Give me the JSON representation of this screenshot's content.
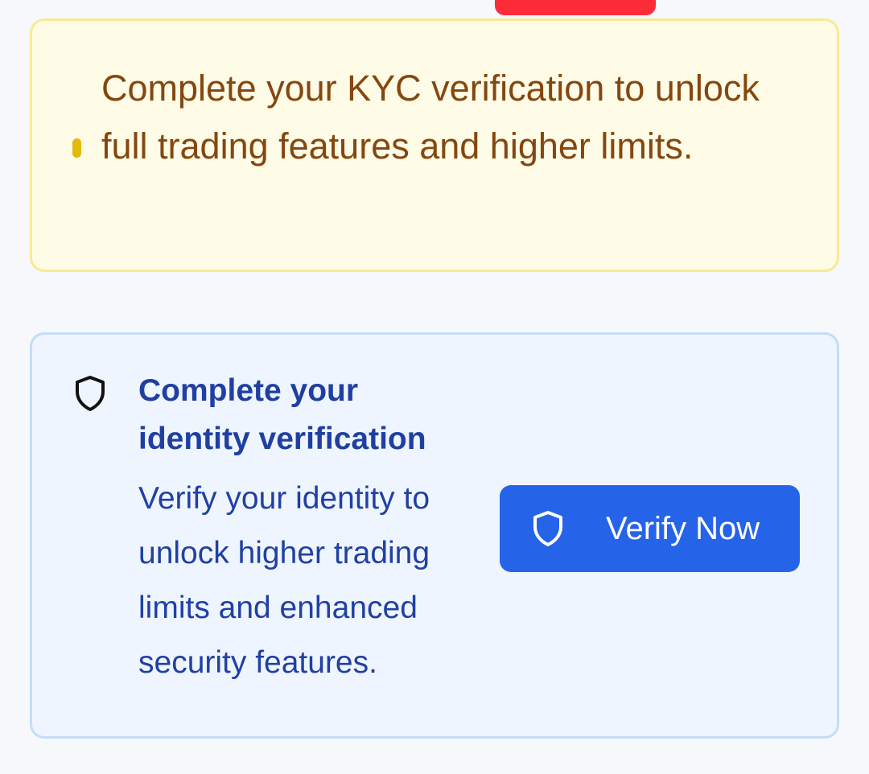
{
  "kyc_banner": {
    "message": "Complete your KYC verification to unlock full trading features and higher limits.",
    "bullet_icon": "dot-indicator",
    "background": "#fefbe6",
    "border": "#f8ea92",
    "text_color": "#85470f",
    "bullet_color": "#e5b90a"
  },
  "verify_card": {
    "icon": "shield-icon",
    "title": "Complete your identity verification",
    "description": "Verify your identity to unlock higher trading limits and enhanced security features.",
    "button": {
      "label": "Verify Now",
      "icon": "shield-icon",
      "color": "#2563e9"
    },
    "background": "#eff5fe",
    "border": "#c4ddf7",
    "title_color": "#1f3fa2"
  },
  "top_indicator": {
    "color": "#fd2c38"
  }
}
